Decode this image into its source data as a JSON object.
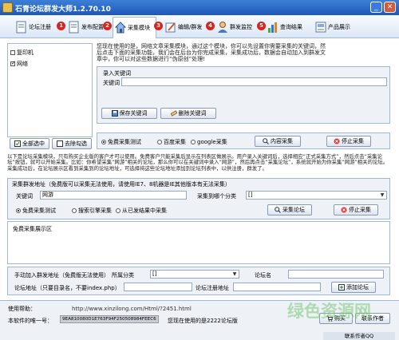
{
  "window": {
    "title": "石青论坛群发大师1.2.70.10",
    "min": "_",
    "close": "✕"
  },
  "toolbar": [
    {
      "label": "论坛注册",
      "badge": "1"
    },
    {
      "label": "发布配置",
      "badge": "2"
    },
    {
      "label": "采集模块",
      "badge": "3"
    },
    {
      "label": "编辑/群发",
      "badge": "4"
    },
    {
      "label": "群发监控",
      "badge": "5"
    },
    {
      "label": "查询结果",
      "badge": "6"
    },
    {
      "label": "产品展示",
      "badge": ""
    }
  ],
  "forums": [
    {
      "label": "复印机",
      "checked": false
    },
    {
      "label": "网络",
      "checked": true
    }
  ],
  "left_buttons": {
    "select_all": "全部选中",
    "deselect": "去除勾选"
  },
  "intro": "您现在使用的是，网络文章采集模块，通过这个模块，你可以先设置你需要采集的关键词，然后点击下面的采集功能，我们会在后台为你完成采集，采集成功后，数据会自动加入到群发文章中，你可以对这些数据进行“伪原创”处理!",
  "keyword_section": {
    "title": "录入关键词",
    "label": "关键词",
    "value": "",
    "save": "保存关键词",
    "delete": "删除关键词"
  },
  "search_engines": {
    "options": [
      "免费采集测试",
      "百度采集",
      "google采集"
    ],
    "selected": 0,
    "collect": "内容采集",
    "stop": "停止采集"
  },
  "notice": "以下是论坛采集模块，只有购买企业版的客户才可以使用。免费客户只能采集后显示在列表区做展示。用户录入关键词后，选择相应“正式采集方式”，然后点击“采集论坛”按钮，就可以开始采集。比如：你希望采集“网游”相关的论坛，那么你可以在关键词中录入“网游”，然后再点击“采集论坛”，系统就开始为你采集“网游”相关的论坛。采集成功后，在论坛展示区看到采集到的论坛地址，可选择将这些论坛地址添加到论坛列表中，以供注册，群发了。",
  "forum_collect": {
    "header": "采集群发地址（免费版可以采集无法使用，请使用IE7、8机器是IE其他版本有无法采集）",
    "keyword_label": "关键词",
    "keyword_value": "网游",
    "category_label": "采集到哪个分类",
    "category_value": "[]",
    "modes": [
      "免费采集测试",
      "搜索引擎采集",
      "从已发结果中采集"
    ],
    "mode_selected": 0,
    "collect": "采集论坛",
    "stop": "停止采集"
  },
  "display_area": {
    "label": "免费采集展示区"
  },
  "manual_add": {
    "label": "手动加入群发地址（免费版无法使用）",
    "category_label": "所属分类",
    "category_value": "[]",
    "name_label": "论坛名",
    "url_label": "论坛地址（只要目录名，不要index.php）",
    "reg_label": "论坛注册地址",
    "add": "添加论坛"
  },
  "footer": {
    "help_label": "使用帮助：",
    "help_url": "http://www.xinzilong.com/Html/?2451.html",
    "machine_label": "本软件的唯一号：",
    "machine_code": "9EA810080D1E763F94F250508984FEEC6",
    "version_text": "您现在使用的是2222论坛版",
    "buy": "购买",
    "contact": "联系作者",
    "contact_qq": "联系作者QQ"
  },
  "watermark": "绿色资源网",
  "colors": {
    "accent": "#1c58b8",
    "badge": "#d8241c",
    "panel_border": "#9fb7d8"
  }
}
